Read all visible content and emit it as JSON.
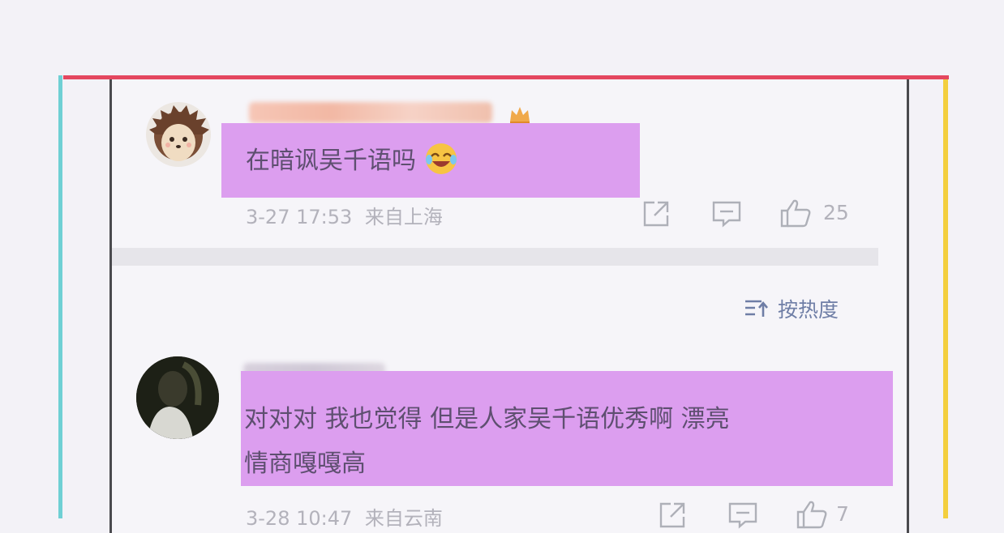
{
  "colors": {
    "top_border": "#e4475f",
    "left_border": "#6fd0d4",
    "right_border": "#f3cf3e",
    "highlight": "#dc9eef"
  },
  "comments": [
    {
      "text": "在暗讽吴千语吗",
      "emoji": "laughing-crying-emoji",
      "date": "3-27 17:53",
      "location": "来自上海",
      "likes": "25",
      "badge": "crown-badge"
    },
    {
      "line1": "对对对 我也觉得 但是人家吴千语优秀啊 漂亮",
      "line2": "情商嘎嘎高",
      "date": "3-28 10:47",
      "location": "来自云南",
      "likes": "7"
    }
  ],
  "sort": {
    "label": "按热度",
    "icon": "sort-icon"
  }
}
